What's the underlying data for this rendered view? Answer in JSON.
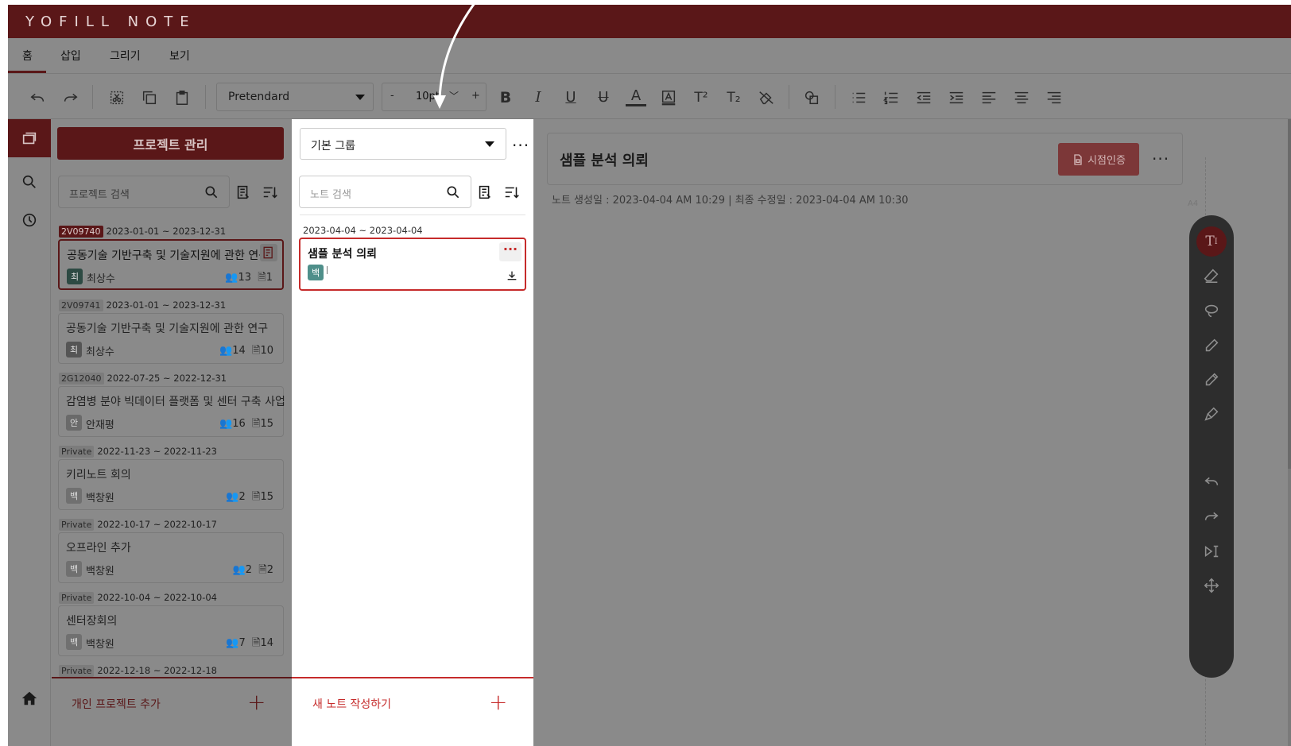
{
  "app": {
    "title": "YOFILL NOTE"
  },
  "menu": {
    "tabs": [
      "홈",
      "삽입",
      "그리기",
      "보기"
    ]
  },
  "toolbar": {
    "font_name": "Pretendard",
    "size_minus": "-",
    "size_value": "10pt",
    "size_plus": "+"
  },
  "projects": {
    "manage_label": "프로젝트 관리",
    "search_placeholder": "프로젝트 검색",
    "items": [
      {
        "code": "2V09740",
        "range": "2023-01-01 ~ 2023-12-31",
        "title": "공동기술 기반구축 및 기술지원에 관한 연구",
        "avatar": "최",
        "owner": "최상수",
        "members": "13",
        "notes": "1"
      },
      {
        "code": "2V09741",
        "range": "2023-01-01 ~ 2023-12-31",
        "title": "공동기술 기반구축 및 기술지원에 관한 연구",
        "avatar": "최",
        "owner": "최상수",
        "members": "14",
        "notes": "10"
      },
      {
        "code": "2G12040",
        "range": "2022-07-25 ~ 2022-12-31",
        "title": "감염병 분야 빅데이터 플랫폼 및 센터 구축 사업",
        "avatar": "안",
        "owner": "안재평",
        "members": "16",
        "notes": "15"
      },
      {
        "code": "Private",
        "range": "2022-11-23 ~ 2022-11-23",
        "title": "키리노트 회의",
        "avatar": "백",
        "owner": "백창원",
        "members": "2",
        "notes": "15"
      },
      {
        "code": "Private",
        "range": "2022-10-17 ~ 2022-10-17",
        "title": "오프라인 추가",
        "avatar": "백",
        "owner": "백창원",
        "members": "2",
        "notes": "2"
      },
      {
        "code": "Private",
        "range": "2022-10-04 ~ 2022-10-04",
        "title": "센터장회의",
        "avatar": "백",
        "owner": "백창원",
        "members": "7",
        "notes": "14"
      },
      {
        "code": "Private",
        "range": "2022-12-18 ~ 2022-12-18"
      }
    ],
    "add_label": "개인 프로젝트 추가",
    "add_icon": "+"
  },
  "notes": {
    "group": "기본 그룹",
    "search_placeholder": "노트 검색",
    "range": "2023-04-04 ~ 2023-04-04",
    "card": {
      "title": "샘플 분석 의뢰",
      "avatar": "백",
      "menu": "···"
    },
    "add_label": "새 노트 작성하기",
    "add_icon": "+"
  },
  "editor": {
    "title": "샘플 분석 의뢰",
    "cert_label": "시점인증",
    "meta": "노트 생성일 : 2023-04-04 AM 10:29  |  최종 수정일 : 2023-04-04 AM 10:30",
    "page_size": "A4"
  },
  "colors": {
    "brand": "#5a1718",
    "accent": "#c62b2b",
    "overlay": "#8a8a8a"
  }
}
